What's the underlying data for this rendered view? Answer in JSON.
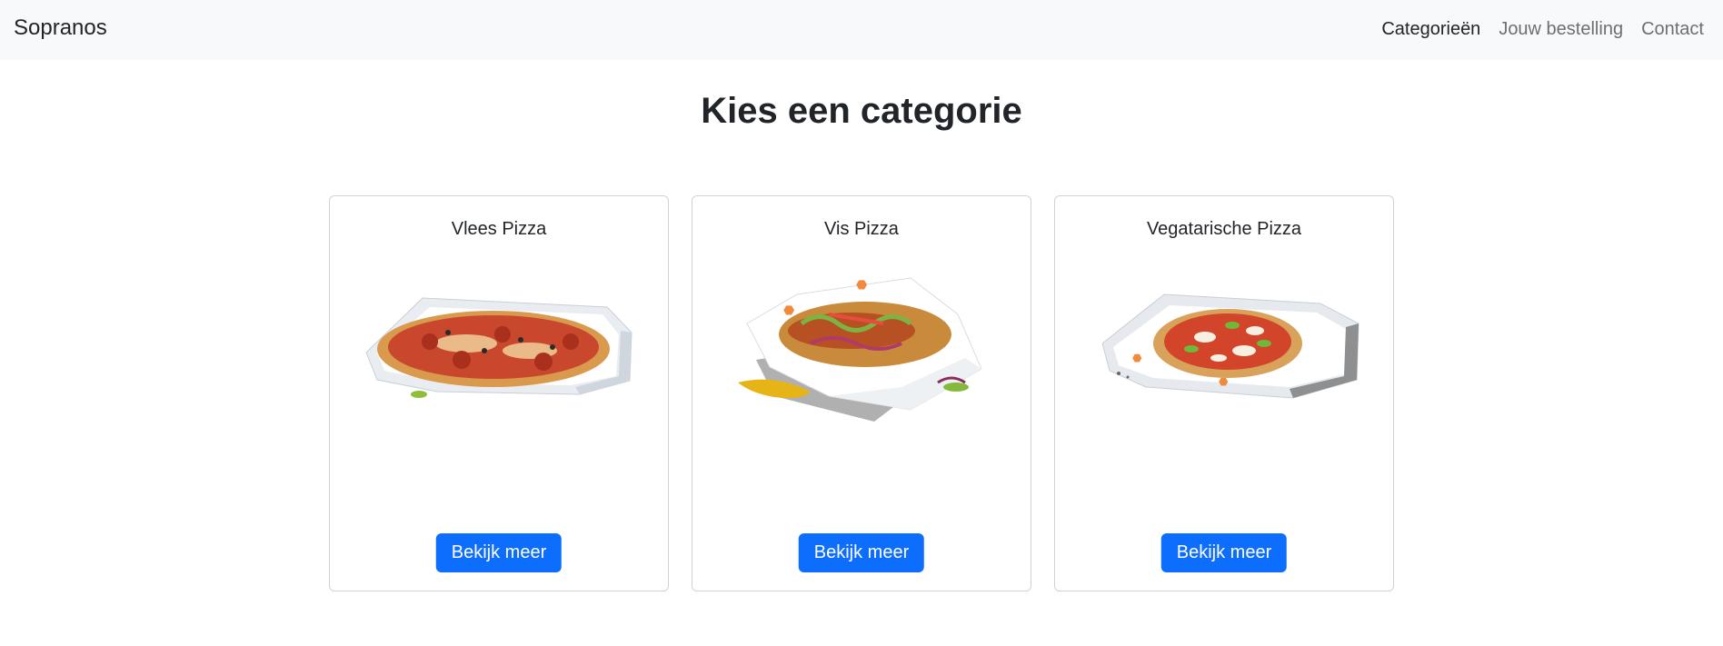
{
  "navbar": {
    "brand": "Sopranos",
    "links": [
      {
        "label": "Categorieën",
        "active": true
      },
      {
        "label": "Jouw bestelling",
        "active": false
      },
      {
        "label": "Contact",
        "active": false
      }
    ]
  },
  "main": {
    "title": "Kies een categorie",
    "cards": [
      {
        "title": "Vlees Pizza",
        "button_label": "Bekijk meer",
        "image": "meat-pizza-in-box"
      },
      {
        "title": "Vis Pizza",
        "button_label": "Bekijk meer",
        "image": "loaded-wrap-in-box"
      },
      {
        "title": "Vegatarische Pizza",
        "button_label": "Bekijk meer",
        "image": "margherita-pizza-in-box"
      }
    ]
  },
  "colors": {
    "navbar_bg": "#f8f9fa",
    "primary_button": "#0d6efd",
    "text": "#212529",
    "card_border": "#cfd3d7"
  }
}
